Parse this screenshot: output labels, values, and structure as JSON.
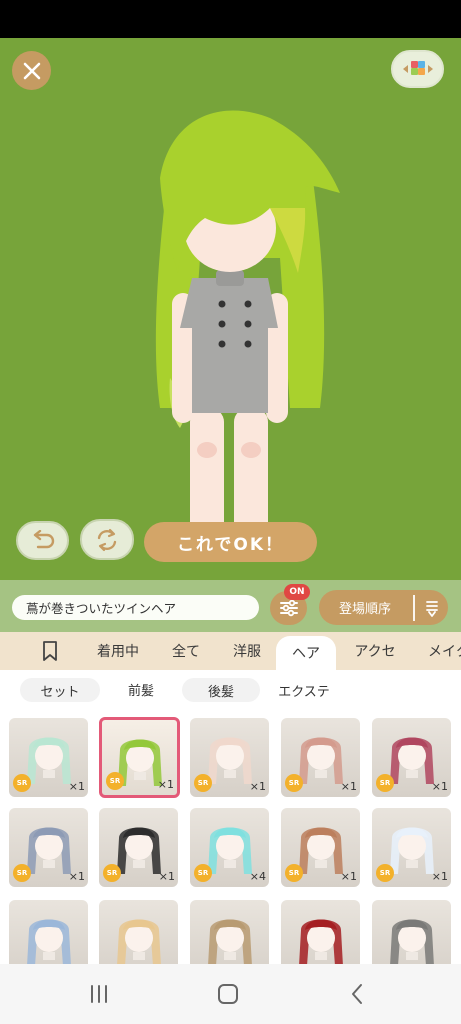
{
  "stage": {
    "ok_button_label": "これでOK！",
    "background_color": "#77a43a"
  },
  "filter": {
    "search_value": "蔦が巻きついたツインヘア",
    "toggle_badge": "ON",
    "sort_label": "登場順序"
  },
  "category_tabs": [
    {
      "label": "",
      "icon": "bookmark-icon"
    },
    {
      "label": "着用中"
    },
    {
      "label": "全て"
    },
    {
      "label": "洋服"
    },
    {
      "label": "ヘア"
    },
    {
      "label": "アクセ"
    },
    {
      "label": "メイク"
    }
  ],
  "active_category": "ヘア",
  "sub_tabs": [
    {
      "label": "セット"
    },
    {
      "label": "前髪"
    },
    {
      "label": "後髪"
    },
    {
      "label": "エクステ"
    }
  ],
  "active_sub_tab": "前髪",
  "items": [
    {
      "rarity": "SR",
      "count": "×1",
      "color": "#b9e6d2"
    },
    {
      "rarity": "SR",
      "count": "×1",
      "color": "#93c83a"
    },
    {
      "rarity": "SR",
      "count": "×1",
      "color": "#f0d8cc"
    },
    {
      "rarity": "SR",
      "count": "×1",
      "color": "#d49b8d"
    },
    {
      "rarity": "SR",
      "count": "×1",
      "color": "#b0465f"
    },
    {
      "rarity": "SR",
      "count": "×1",
      "color": "#8d9bb5"
    },
    {
      "rarity": "SR",
      "count": "×1",
      "color": "#2d2d2d"
    },
    {
      "rarity": "SR",
      "count": "×4",
      "color": "#7fe0df"
    },
    {
      "rarity": "SR",
      "count": "×1",
      "color": "#bc7f5d"
    },
    {
      "rarity": "SR",
      "count": "×1",
      "color": "#e8f1fb"
    },
    {
      "rarity": "",
      "count": "",
      "color": "#9bb7d9"
    },
    {
      "rarity": "",
      "count": "",
      "color": "#e8c78f"
    },
    {
      "rarity": "",
      "count": "",
      "color": "#b89b72"
    },
    {
      "rarity": "",
      "count": "",
      "color": "#a51f22"
    },
    {
      "rarity": "",
      "count": "",
      "color": "#7a7a78"
    }
  ],
  "accent_colors": {
    "gold": "#c59b62",
    "badge_red": "#e04743",
    "selected_pink": "#e35a78",
    "sr_badge": "#f3b12b"
  }
}
